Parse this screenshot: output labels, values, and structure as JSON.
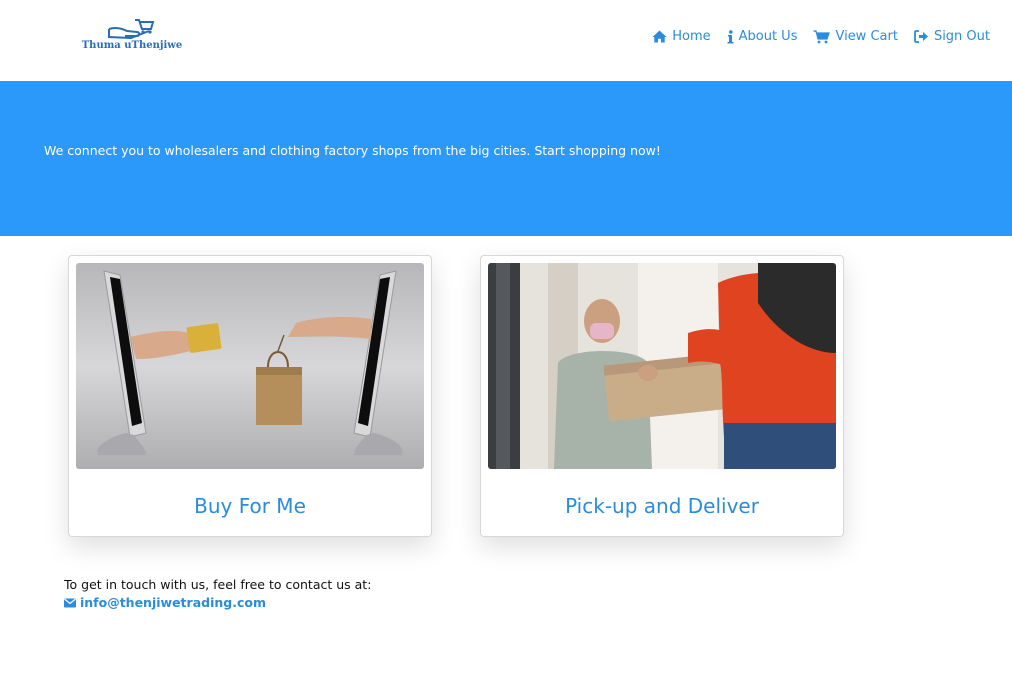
{
  "brand": {
    "name": "Thuma uThenjiwe",
    "icon": "hand-cart-logo"
  },
  "nav": {
    "items": [
      {
        "label": "Home",
        "icon": "home-icon"
      },
      {
        "label": "About Us",
        "icon": "info-icon"
      },
      {
        "label": "View Cart",
        "icon": "cart-icon"
      },
      {
        "label": "Sign Out",
        "icon": "sign-out-icon"
      }
    ]
  },
  "hero": {
    "text": "We connect you to wholesalers and clothing factory shops from the big cities. Start shopping now!"
  },
  "cards": [
    {
      "title": "Buy For Me",
      "image": "online-shopping-monitors-photo"
    },
    {
      "title": "Pick-up and Deliver",
      "image": "delivery-person-handing-box-photo"
    }
  ],
  "contact": {
    "intro": "To get in touch with us, feel free to contact us at:",
    "email": "info@thenjiwetrading.com",
    "icon": "envelope-icon"
  },
  "colors": {
    "accent": "#2a8cdf",
    "hero": "#2b99fa",
    "logo": "#2b6cb8"
  }
}
